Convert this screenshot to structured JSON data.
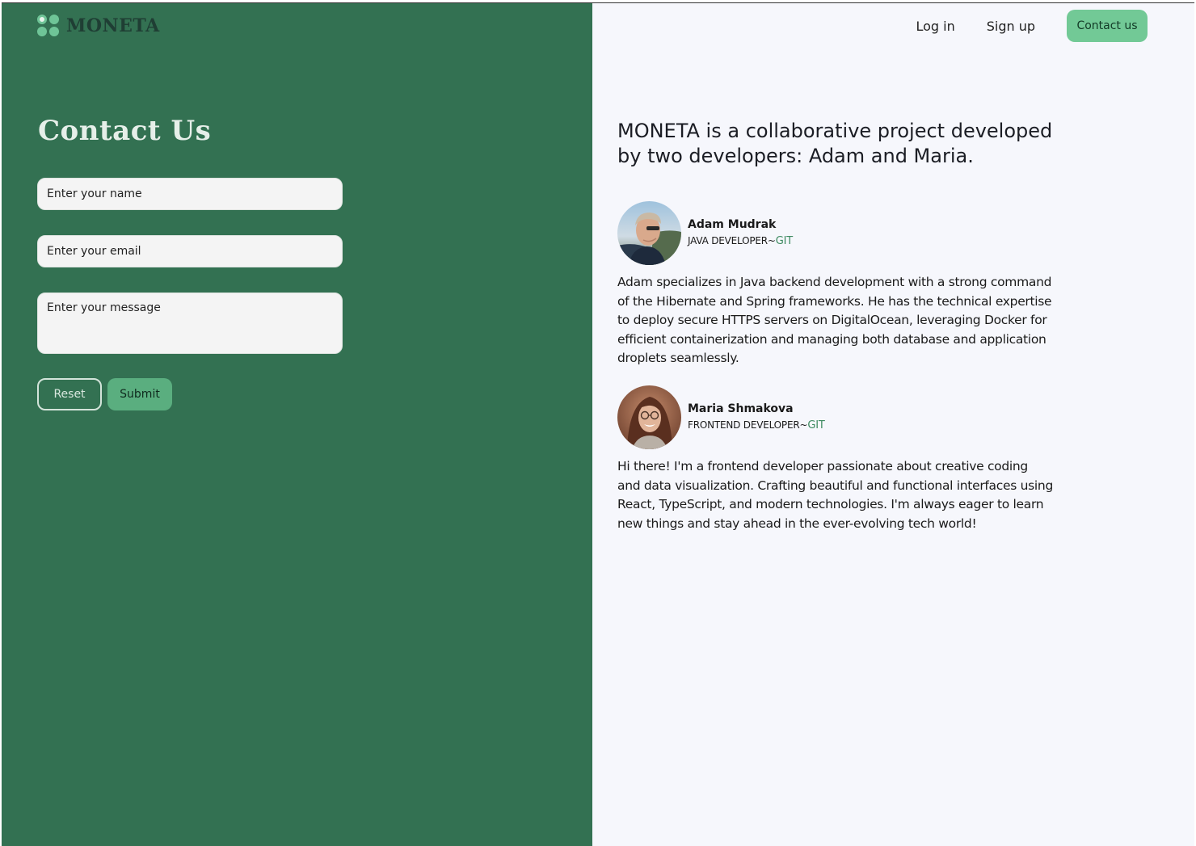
{
  "brand": {
    "name": "MONETA",
    "logo_icon": "four-dots-logo-icon"
  },
  "colors": {
    "panel_green": "#337152",
    "accent_green": "#72c996",
    "submit_green": "#5aae7f",
    "right_bg": "#f6f7fc",
    "git_link": "#3d8a60"
  },
  "nav": {
    "login_label": "Log in",
    "signup_label": "Sign up",
    "contact_label": "Contact us"
  },
  "form": {
    "title": "Contact Us",
    "name_placeholder": "Enter your name",
    "email_placeholder": "Enter your email",
    "message_placeholder": "Enter your message",
    "reset_label": "Reset",
    "submit_label": "Submit"
  },
  "about": {
    "intro": "MONETA is a collaborative project developed by two developers: Adam and Maria.",
    "people": [
      {
        "name": "Adam Mudrak",
        "role": "JAVA DEVELOPER~",
        "link_label": "GIT",
        "bio": "Adam specializes in Java backend development with a strong command of the Hibernate and Spring frameworks. He has the technical expertise to deploy secure HTTPS servers on DigitalOcean, leveraging Docker for efficient containerization and managing both database and application droplets seamlessly."
      },
      {
        "name": "Maria Shmakova",
        "role": "FRONTEND DEVELOPER~",
        "link_label": "GIT",
        "bio": "Hi there! I'm a frontend developer passionate about creative coding and data visualization. Crafting beautiful and functional interfaces using React, TypeScript, and modern technologies. I'm always eager to learn new things and stay ahead in the ever-evolving tech world!"
      }
    ]
  }
}
